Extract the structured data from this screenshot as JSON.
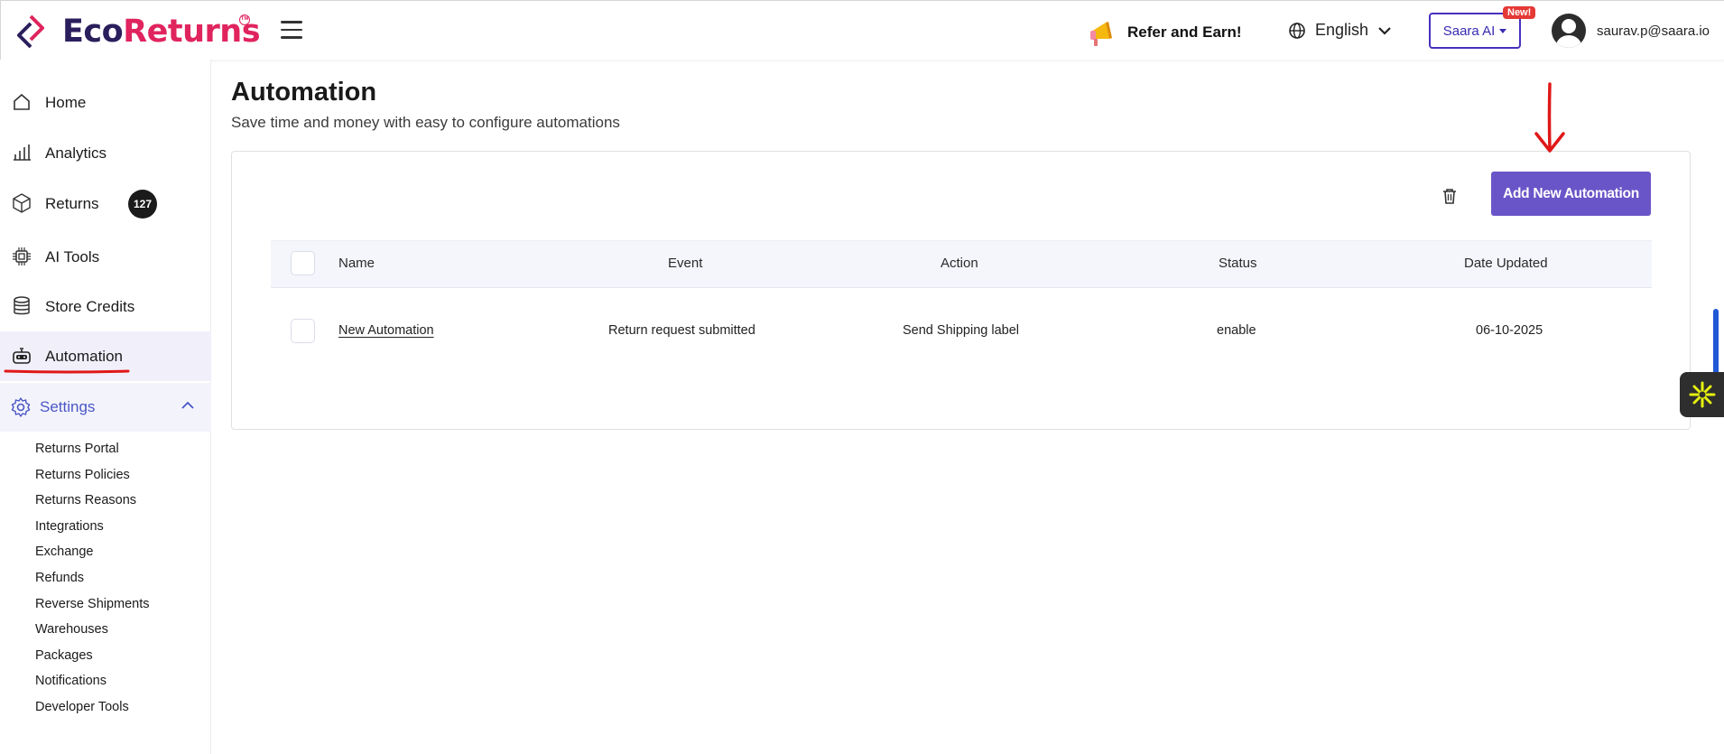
{
  "brand": {
    "name_part1": "Eco",
    "name_part2": "Returns",
    "tm": "TM",
    "color_dark": "#2b1e5c",
    "color_accent": "#e0245e"
  },
  "header": {
    "refer_label": "Refer and Earn!",
    "language": "English",
    "saara_label": "Saara AI",
    "saara_badge": "New!",
    "user_email": "saurav.p@saara.io"
  },
  "sidebar": {
    "items": [
      {
        "label": "Home",
        "icon": "home-icon"
      },
      {
        "label": "Analytics",
        "icon": "bar-chart-icon"
      },
      {
        "label": "Returns",
        "icon": "box-icon",
        "badge": "127"
      },
      {
        "label": "AI Tools",
        "icon": "chip-icon"
      },
      {
        "label": "Store Credits",
        "icon": "coins-stack-icon"
      },
      {
        "label": "Automation",
        "icon": "robot-icon",
        "active": true
      }
    ],
    "settings": {
      "label": "Settings",
      "icon": "gear-icon",
      "expanded": true,
      "sub_items": [
        "Returns Portal",
        "Returns Policies",
        "Returns Reasons",
        "Integrations",
        "Exchange",
        "Refunds",
        "Reverse Shipments",
        "Warehouses",
        "Packages",
        "Notifications",
        "Developer Tools"
      ]
    }
  },
  "main": {
    "title": "Automation",
    "subtitle": "Save time and money with easy to configure automations",
    "add_button": "Add New Automation",
    "accent_color": "#6a55c8",
    "table": {
      "columns": [
        "Name",
        "Event",
        "Action",
        "Status",
        "Date Updated"
      ],
      "rows": [
        {
          "name": "New Automation",
          "event": "Return request submitted",
          "action": "Send Shipping label",
          "status": "enable",
          "date": "06-10-2025"
        }
      ]
    }
  }
}
